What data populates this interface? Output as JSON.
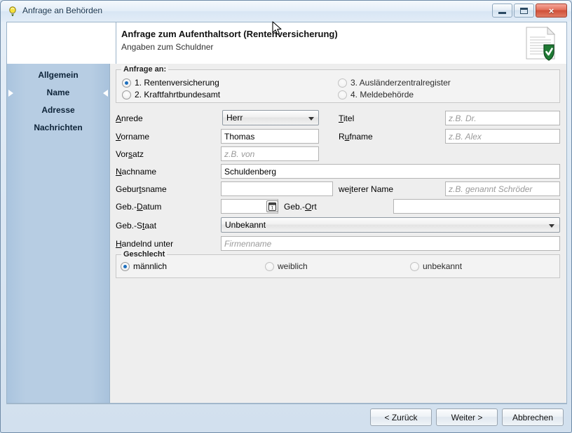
{
  "window": {
    "title": "Anfrage an Behörden",
    "title_icon": "lightbulb-icon",
    "buttons": {
      "minimize": "minimize-icon",
      "maximize": "maximize-icon",
      "close": "×"
    }
  },
  "header": {
    "title": "Anfrage zum Aufenthaltsort (Rentenversicherung)",
    "subtitle": "Angaben zum Schuldner",
    "icon": "document-shield-icon"
  },
  "sidebar": {
    "items": [
      {
        "label": "Allgemein",
        "active": false
      },
      {
        "label": "Name",
        "active": true
      },
      {
        "label": "Adresse",
        "active": false
      },
      {
        "label": "Nachrichten",
        "active": false
      }
    ]
  },
  "form": {
    "request_group": {
      "legend": "Anfrage an:",
      "options": [
        {
          "label": "1. Rentenversicherung",
          "selected": true,
          "disabled": false
        },
        {
          "label": "2. Kraftfahrtbundesamt",
          "selected": false,
          "disabled": false
        },
        {
          "label": "3. Ausländerzentralregister",
          "selected": false,
          "disabled": true
        },
        {
          "label": "4. Meldebehörde",
          "selected": false,
          "disabled": true
        }
      ]
    },
    "fields": {
      "anrede": {
        "label": "Anrede",
        "accel": "n",
        "value": "Herr"
      },
      "titel": {
        "label": "Titel",
        "accel": "T",
        "value": "",
        "placeholder": "z.B. Dr."
      },
      "vorname": {
        "label": "Vorname",
        "accel": "V",
        "value": "Thomas",
        "placeholder": ""
      },
      "rufname": {
        "label": "Rufname",
        "accel": "u",
        "value": "",
        "placeholder": "z.B. Alex"
      },
      "vorsatz": {
        "label": "Vorsatz",
        "accel": "s",
        "value": "",
        "placeholder": "z.B. von"
      },
      "nachname": {
        "label": "Nachname",
        "accel": "N",
        "value": "Schuldenberg",
        "placeholder": ""
      },
      "geburtsname": {
        "label": "Geburtsname",
        "accel": "t",
        "value": "",
        "placeholder": ""
      },
      "weiterer_name": {
        "label": "weiterer Name",
        "accel": "i",
        "value": "",
        "placeholder": "z.B. genannt Schröder"
      },
      "geb_datum": {
        "label": "Geb.-Datum",
        "accel": "D",
        "value": "",
        "placeholder": "",
        "button_icon": "calendar-icon"
      },
      "geb_ort": {
        "label": "Geb.-Ort",
        "accel": "O",
        "value": "",
        "placeholder": ""
      },
      "geb_staat": {
        "label": "Geb.-Staat",
        "accel": "t",
        "value": "Unbekannt"
      },
      "handelnd": {
        "label": "Handelnd unter",
        "accel": "H",
        "value": "",
        "placeholder": "Firmenname"
      }
    },
    "gender_group": {
      "legend": "Geschlecht",
      "options": [
        {
          "label": "männlich",
          "selected": true,
          "disabled": false
        },
        {
          "label": "weiblich",
          "selected": false,
          "disabled": true
        },
        {
          "label": "unbekannt",
          "selected": false,
          "disabled": true
        }
      ]
    }
  },
  "footer": {
    "back": "< Zurück",
    "next": "Weiter >",
    "cancel": "Abbrechen"
  }
}
